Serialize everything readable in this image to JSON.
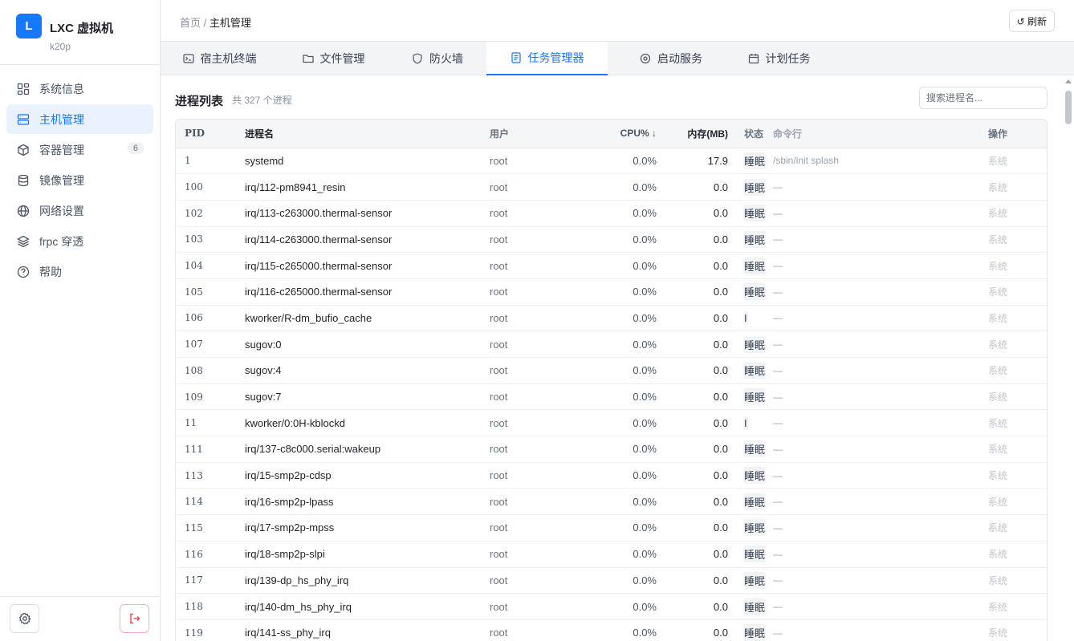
{
  "brand": {
    "logo_letter": "L",
    "title": "LXC 虚拟机",
    "subtitle": "k20p"
  },
  "sidebar": {
    "items": [
      {
        "label": "系统信息",
        "icon": "dashboard-icon"
      },
      {
        "label": "主机管理",
        "icon": "server-icon",
        "active": true
      },
      {
        "label": "容器管理",
        "icon": "box-icon",
        "badge": "6"
      },
      {
        "label": "镜像管理",
        "icon": "database-icon"
      },
      {
        "label": "网络设置",
        "icon": "globe-icon"
      },
      {
        "label": "frpc 穿透",
        "icon": "layers-icon"
      },
      {
        "label": "帮助",
        "icon": "help-icon"
      }
    ]
  },
  "breadcrumb": {
    "home": "首页",
    "separator": "/",
    "current": "主机管理"
  },
  "refresh_label": "↺ 刷新",
  "tabs": [
    {
      "label": "宿主机终端",
      "icon": "terminal-icon"
    },
    {
      "label": "文件管理",
      "icon": "folder-icon"
    },
    {
      "label": "防火墙",
      "icon": "shield-icon"
    },
    {
      "label": "任务管理器",
      "icon": "task-icon",
      "active": true
    },
    {
      "label": "启动服务",
      "icon": "service-icon"
    },
    {
      "label": "计划任务",
      "icon": "calendar-icon"
    }
  ],
  "process_list": {
    "title": "进程列表",
    "count_text": "共 327 个进程",
    "search_placeholder": "搜索进程名...",
    "columns": {
      "pid": "PID",
      "name": "进程名",
      "user": "用户",
      "cpu": "CPU% ↓",
      "mem": "内存(MB)",
      "state": "状态",
      "cmd": "命令行",
      "op": "操作"
    },
    "rows": [
      {
        "pid": "1",
        "name": "systemd",
        "user": "root",
        "cpu": "0.0%",
        "mem": "17.9",
        "state": "睡眠",
        "cmd": "/sbin/init splash",
        "op": "系统"
      },
      {
        "pid": "100",
        "name": "irq/112-pm8941_resin",
        "user": "root",
        "cpu": "0.0%",
        "mem": "0.0",
        "state": "睡眠",
        "cmd": "—",
        "op": "系统"
      },
      {
        "pid": "102",
        "name": "irq/113-c263000.thermal-sensor",
        "user": "root",
        "cpu": "0.0%",
        "mem": "0.0",
        "state": "睡眠",
        "cmd": "—",
        "op": "系统"
      },
      {
        "pid": "103",
        "name": "irq/114-c263000.thermal-sensor",
        "user": "root",
        "cpu": "0.0%",
        "mem": "0.0",
        "state": "睡眠",
        "cmd": "—",
        "op": "系统"
      },
      {
        "pid": "104",
        "name": "irq/115-c265000.thermal-sensor",
        "user": "root",
        "cpu": "0.0%",
        "mem": "0.0",
        "state": "睡眠",
        "cmd": "—",
        "op": "系统"
      },
      {
        "pid": "105",
        "name": "irq/116-c265000.thermal-sensor",
        "user": "root",
        "cpu": "0.0%",
        "mem": "0.0",
        "state": "睡眠",
        "cmd": "—",
        "op": "系统"
      },
      {
        "pid": "106",
        "name": "kworker/R-dm_bufio_cache",
        "user": "root",
        "cpu": "0.0%",
        "mem": "0.0",
        "state": "I",
        "cmd": "—",
        "op": "系统"
      },
      {
        "pid": "107",
        "name": "sugov:0",
        "user": "root",
        "cpu": "0.0%",
        "mem": "0.0",
        "state": "睡眠",
        "cmd": "—",
        "op": "系统"
      },
      {
        "pid": "108",
        "name": "sugov:4",
        "user": "root",
        "cpu": "0.0%",
        "mem": "0.0",
        "state": "睡眠",
        "cmd": "—",
        "op": "系统"
      },
      {
        "pid": "109",
        "name": "sugov:7",
        "user": "root",
        "cpu": "0.0%",
        "mem": "0.0",
        "state": "睡眠",
        "cmd": "—",
        "op": "系统"
      },
      {
        "pid": "11",
        "name": "kworker/0:0H-kblockd",
        "user": "root",
        "cpu": "0.0%",
        "mem": "0.0",
        "state": "I",
        "cmd": "—",
        "op": "系统"
      },
      {
        "pid": "111",
        "name": "irq/137-c8c000.serial:wakeup",
        "user": "root",
        "cpu": "0.0%",
        "mem": "0.0",
        "state": "睡眠",
        "cmd": "—",
        "op": "系统"
      },
      {
        "pid": "113",
        "name": "irq/15-smp2p-cdsp",
        "user": "root",
        "cpu": "0.0%",
        "mem": "0.0",
        "state": "睡眠",
        "cmd": "—",
        "op": "系统"
      },
      {
        "pid": "114",
        "name": "irq/16-smp2p-lpass",
        "user": "root",
        "cpu": "0.0%",
        "mem": "0.0",
        "state": "睡眠",
        "cmd": "—",
        "op": "系统"
      },
      {
        "pid": "115",
        "name": "irq/17-smp2p-mpss",
        "user": "root",
        "cpu": "0.0%",
        "mem": "0.0",
        "state": "睡眠",
        "cmd": "—",
        "op": "系统"
      },
      {
        "pid": "116",
        "name": "irq/18-smp2p-slpi",
        "user": "root",
        "cpu": "0.0%",
        "mem": "0.0",
        "state": "睡眠",
        "cmd": "—",
        "op": "系统"
      },
      {
        "pid": "117",
        "name": "irq/139-dp_hs_phy_irq",
        "user": "root",
        "cpu": "0.0%",
        "mem": "0.0",
        "state": "睡眠",
        "cmd": "—",
        "op": "系统"
      },
      {
        "pid": "118",
        "name": "irq/140-dm_hs_phy_irq",
        "user": "root",
        "cpu": "0.0%",
        "mem": "0.0",
        "state": "睡眠",
        "cmd": "—",
        "op": "系统"
      },
      {
        "pid": "119",
        "name": "irq/141-ss_phy_irq",
        "user": "root",
        "cpu": "0.0%",
        "mem": "0.0",
        "state": "睡眠",
        "cmd": "—",
        "op": "系统"
      }
    ]
  },
  "colors": {
    "accent": "#1677ff",
    "active_bg": "#eaf2ff",
    "logout": "#e5484d"
  }
}
